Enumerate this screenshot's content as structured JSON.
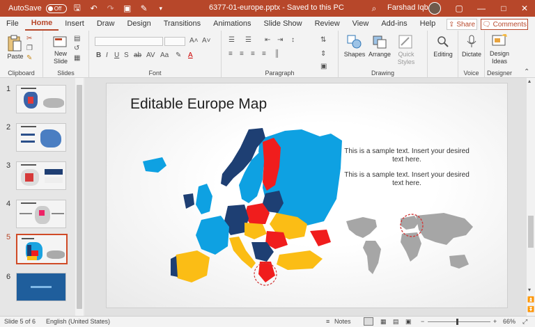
{
  "titlebar": {
    "autosave_label": "AutoSave",
    "autosave_state": "Off",
    "doc_title": "6377-01-europe.pptx - Saved to this PC",
    "user": "Farshad Iqbal",
    "icons": [
      "save-icon",
      "undo-icon",
      "redo-icon",
      "presenter-icon",
      "brush-icon",
      "dropdown-icon",
      "search-icon"
    ]
  },
  "menu": {
    "tabs": [
      "File",
      "Home",
      "Insert",
      "Draw",
      "Design",
      "Transitions",
      "Animations",
      "Slide Show",
      "Review",
      "View",
      "Add-ins",
      "Help"
    ],
    "active": "Home",
    "share_label": "Share",
    "comments_label": "Comments"
  },
  "ribbon": {
    "paste_label": "Paste",
    "new_slide_label": "New Slide",
    "shapes_label": "Shapes",
    "arrange_label": "Arrange",
    "quick_styles_label": "Quick Styles",
    "editing_label": "Editing",
    "dictate_label": "Dictate",
    "design_ideas_label": "Design Ideas",
    "groups": {
      "clipboard": "Clipboard",
      "slides": "Slides",
      "font": "Font",
      "paragraph": "Paragraph",
      "drawing": "Drawing",
      "voice": "Voice",
      "designer": "Designer"
    }
  },
  "thumbnails": [
    {
      "num": "1"
    },
    {
      "num": "2"
    },
    {
      "num": "3"
    },
    {
      "num": "4"
    },
    {
      "num": "5"
    },
    {
      "num": "6"
    }
  ],
  "slide": {
    "title": "Editable Europe Map",
    "text1": "This is a sample text. Insert your desired text here.",
    "text2": "This is a sample text. Insert your desired text here."
  },
  "status": {
    "slide_of": "Slide 5 of 6",
    "language": "English (United States)",
    "notes": "Notes",
    "zoom": "66%"
  },
  "colors": {
    "accent": "#b7472a",
    "map_blue": "#0ea1e2",
    "map_navy": "#1e3f73",
    "map_red": "#f01d1d",
    "map_yellow": "#fbbd15",
    "world_gray": "#a6a6a6"
  }
}
